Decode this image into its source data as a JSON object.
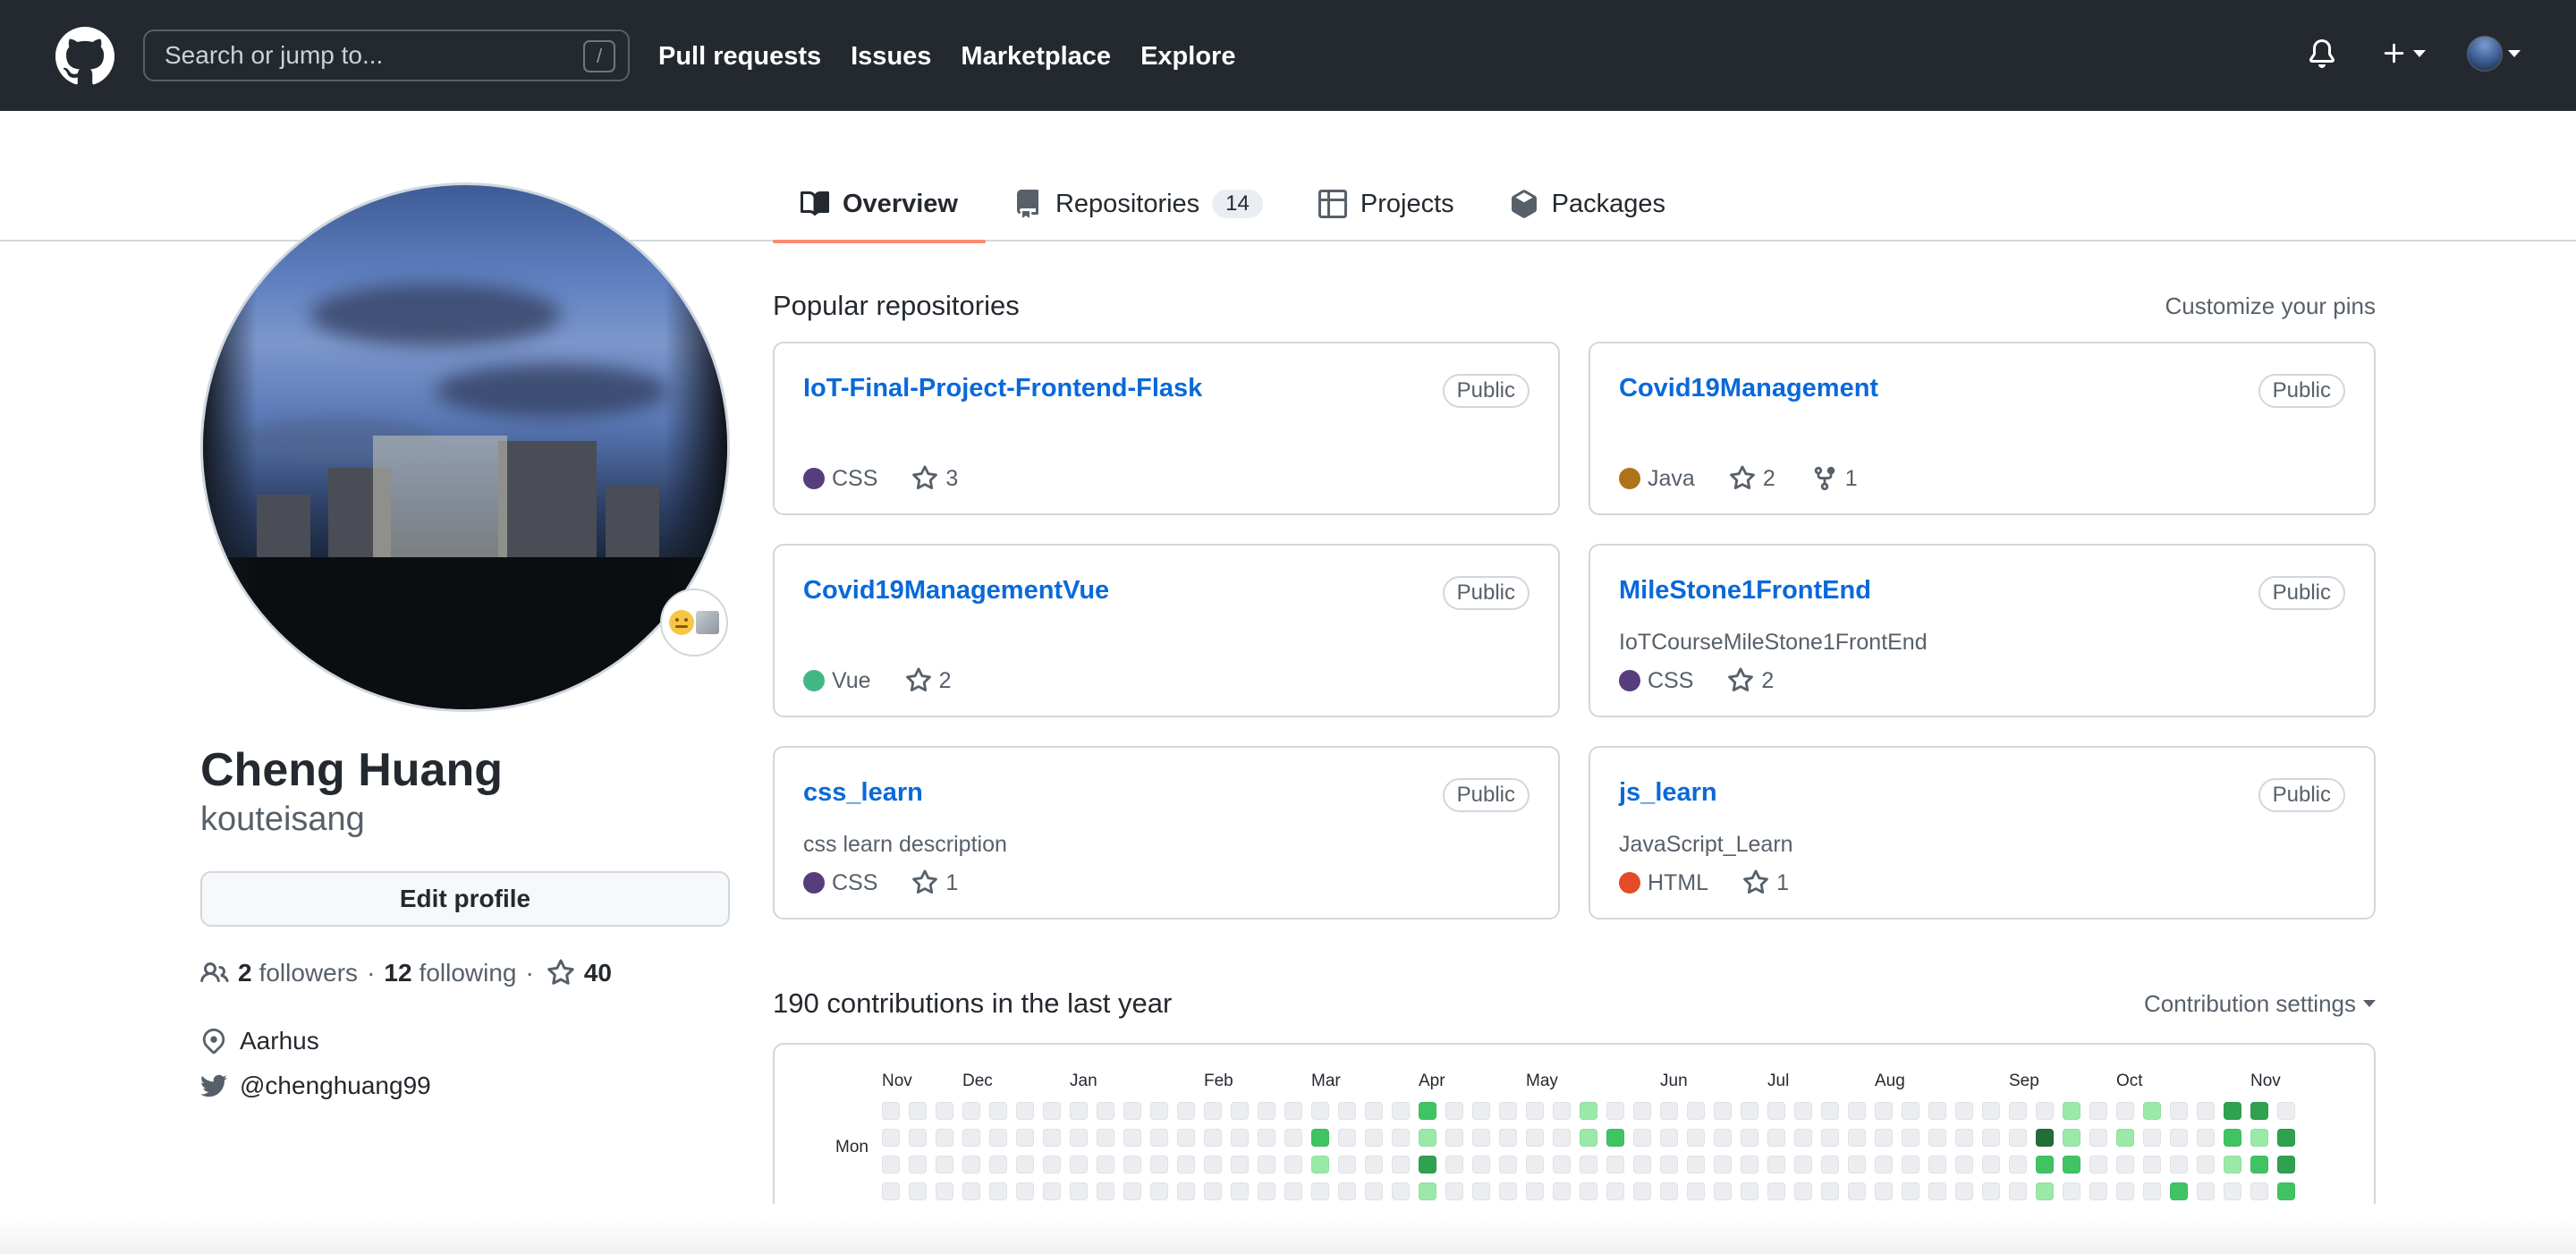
{
  "header": {
    "search_placeholder": "Search or jump to...",
    "search_shortcut": "/",
    "nav": [
      "Pull requests",
      "Issues",
      "Marketplace",
      "Explore"
    ]
  },
  "tabs": [
    {
      "label": "Overview",
      "active": true,
      "icon": "book-icon"
    },
    {
      "label": "Repositories",
      "count": "14",
      "icon": "repo-icon"
    },
    {
      "label": "Projects",
      "icon": "table-icon"
    },
    {
      "label": "Packages",
      "icon": "package-icon"
    }
  ],
  "profile": {
    "name": "Cheng Huang",
    "login": "kouteisang",
    "edit_label": "Edit profile",
    "followers_count": "2",
    "followers_label": "followers",
    "sep": "·",
    "following_count": "12",
    "following_label": "following",
    "stars": "40",
    "location": "Aarhus",
    "twitter": "@chenghuang99"
  },
  "popular": {
    "title": "Popular repositories",
    "customize": "Customize your pins",
    "repos": [
      {
        "name": "IoT-Final-Project-Frontend-Flask",
        "visibility": "Public",
        "description": "",
        "language": "CSS",
        "lang_color": "#563d7c",
        "stars": "3",
        "forks": ""
      },
      {
        "name": "Covid19Management",
        "visibility": "Public",
        "description": "",
        "language": "Java",
        "lang_color": "#b07219",
        "stars": "2",
        "forks": "1"
      },
      {
        "name": "Covid19ManagementVue",
        "visibility": "Public",
        "description": "",
        "language": "Vue",
        "lang_color": "#41b883",
        "stars": "2",
        "forks": ""
      },
      {
        "name": "MileStone1FrontEnd",
        "visibility": "Public",
        "description": "IoTCourseMileStone1FrontEnd",
        "language": "CSS",
        "lang_color": "#563d7c",
        "stars": "2",
        "forks": ""
      },
      {
        "name": "css_learn",
        "visibility": "Public",
        "description": "css learn description",
        "language": "CSS",
        "lang_color": "#563d7c",
        "stars": "1",
        "forks": ""
      },
      {
        "name": "js_learn",
        "visibility": "Public",
        "description": "JavaScript_Learn",
        "language": "HTML",
        "lang_color": "#e34c26",
        "stars": "1",
        "forks": ""
      }
    ]
  },
  "contributions": {
    "title": "190 contributions in the last year",
    "settings_label": "Contribution settings",
    "months": [
      "Nov",
      "Dec",
      "Jan",
      "Feb",
      "Mar",
      "Apr",
      "May",
      "Jun",
      "Jul",
      "Aug",
      "Sep",
      "Oct",
      "Nov"
    ],
    "day_label": "Mon",
    "level_colors": [
      "#ebedf0",
      "#9be9a8",
      "#40c463",
      "#30a14e",
      "#216e39"
    ]
  }
}
